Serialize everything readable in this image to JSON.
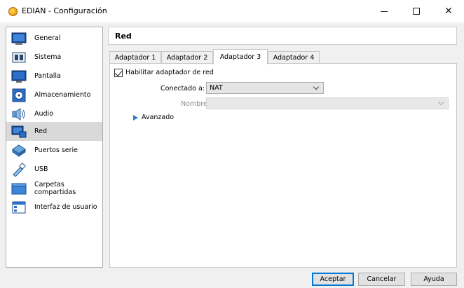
{
  "window": {
    "title": "EDIAN - Configuración",
    "minimize": "—",
    "maximize": "□",
    "close": "✕"
  },
  "sidebar": {
    "items": [
      {
        "label": "General",
        "icon": "general-icon"
      },
      {
        "label": "Sistema",
        "icon": "system-icon"
      },
      {
        "label": "Pantalla",
        "icon": "display-icon"
      },
      {
        "label": "Almacenamiento",
        "icon": "storage-icon"
      },
      {
        "label": "Audio",
        "icon": "audio-icon"
      },
      {
        "label": "Red",
        "icon": "network-icon",
        "selected": true
      },
      {
        "label": "Puertos serie",
        "icon": "serial-ports-icon"
      },
      {
        "label": "USB",
        "icon": "usb-icon"
      },
      {
        "label": "Carpetas compartidas",
        "icon": "shared-folders-icon"
      },
      {
        "label": "Interfaz de usuario",
        "icon": "user-interface-icon"
      }
    ]
  },
  "panel": {
    "title": "Red",
    "tabs": [
      {
        "label": "Adaptador 1"
      },
      {
        "label": "Adaptador 2"
      },
      {
        "label": "Adaptador 3",
        "active": true
      },
      {
        "label": "Adaptador 4"
      }
    ],
    "enable_label": "Habilitar adaptador de red",
    "enable_checked": true,
    "connected_label": "Conectado a:",
    "connected_value": "NAT",
    "name_label": "Nombre:",
    "name_value": "",
    "advanced_label": "Avanzado"
  },
  "buttons": {
    "accept": "Aceptar",
    "cancel": "Cancelar",
    "help": "Ayuda"
  },
  "colors": {
    "selected_bg": "#d9d9d9",
    "accent": "#0078d7",
    "advanced_arrow": "#2b7fd6"
  }
}
